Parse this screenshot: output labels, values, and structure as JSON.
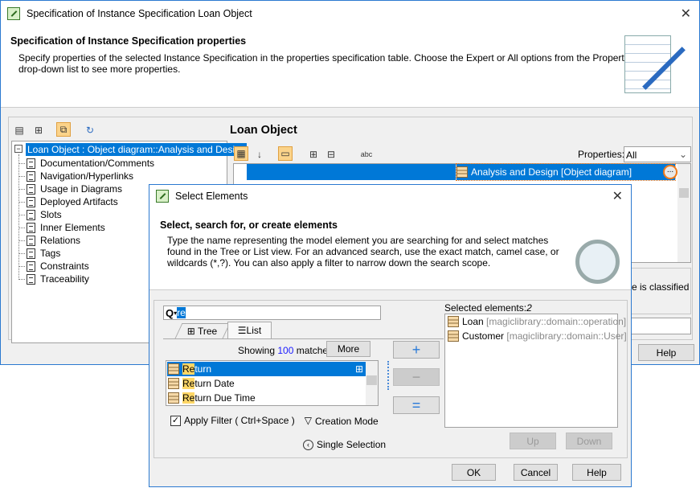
{
  "main_window": {
    "title": "Specification of Instance Specification Loan Object",
    "header_title": "Specification of Instance Specification properties",
    "header_desc_1": "Specify properties of the selected Instance Specification in the properties specification table. Choose the Expert or All options from the Properties",
    "header_desc_2": "drop-down list to see more properties.",
    "tree": {
      "root": "Loan Object : Object diagram::Analysis and Design",
      "items": [
        "Documentation/Comments",
        "Navigation/Hyperlinks",
        "Usage in Diagrams",
        "Deployed Artifacts",
        "Slots",
        "Inner Elements",
        "Relations",
        "Tags",
        "Constraints",
        "Traceability"
      ]
    },
    "panel_title": "Loan Object",
    "properties_label": "Properties:",
    "properties_value": "All",
    "selected_cell": "Analysis and Design [Object diagram]",
    "ellipsis": "...",
    "description_fragment": "ce is classified",
    "help": "Help"
  },
  "dialog": {
    "title": "Select Elements",
    "header_title": "Select, search for, or create elements",
    "desc": [
      "Type the name representing the model element you are searching for and select matches",
      "found in the Tree or List view. For an advanced search, use the exact match, camel case, or",
      "wildcards (*,?). You can also apply a filter to narrow down the search scope."
    ],
    "search_value": "re",
    "tabs": [
      "Tree",
      "List"
    ],
    "showing_prefix": "Showing",
    "showing_count": "100",
    "showing_suffix": "matches",
    "more": "More",
    "results": [
      {
        "hl": "Re",
        "rest": "turn"
      },
      {
        "hl": "Re",
        "rest": "turn Date"
      },
      {
        "hl": "Re",
        "rest": "turn Due Time"
      }
    ],
    "apply_filter": "Apply Filter ( Ctrl+Space )",
    "apply_filter_checked": true,
    "creation_mode": "Creation Mode",
    "single_selection": "Single Selection",
    "add": "+",
    "remove": "−",
    "replace": "=",
    "selected_label": "Selected elements:",
    "selected_count": "2",
    "selected": [
      {
        "name": "Loan",
        "path": "[magiclibrary::domain::operation]"
      },
      {
        "name": "Customer",
        "path": "[magiclibrary::domain::User]"
      }
    ],
    "up": "Up",
    "down": "Down",
    "ok": "OK",
    "cancel": "Cancel",
    "help": "Help"
  },
  "colors": {
    "accent": "#0078d7",
    "highlight": "#ffd766",
    "focus_ring": "#f07a1a"
  }
}
